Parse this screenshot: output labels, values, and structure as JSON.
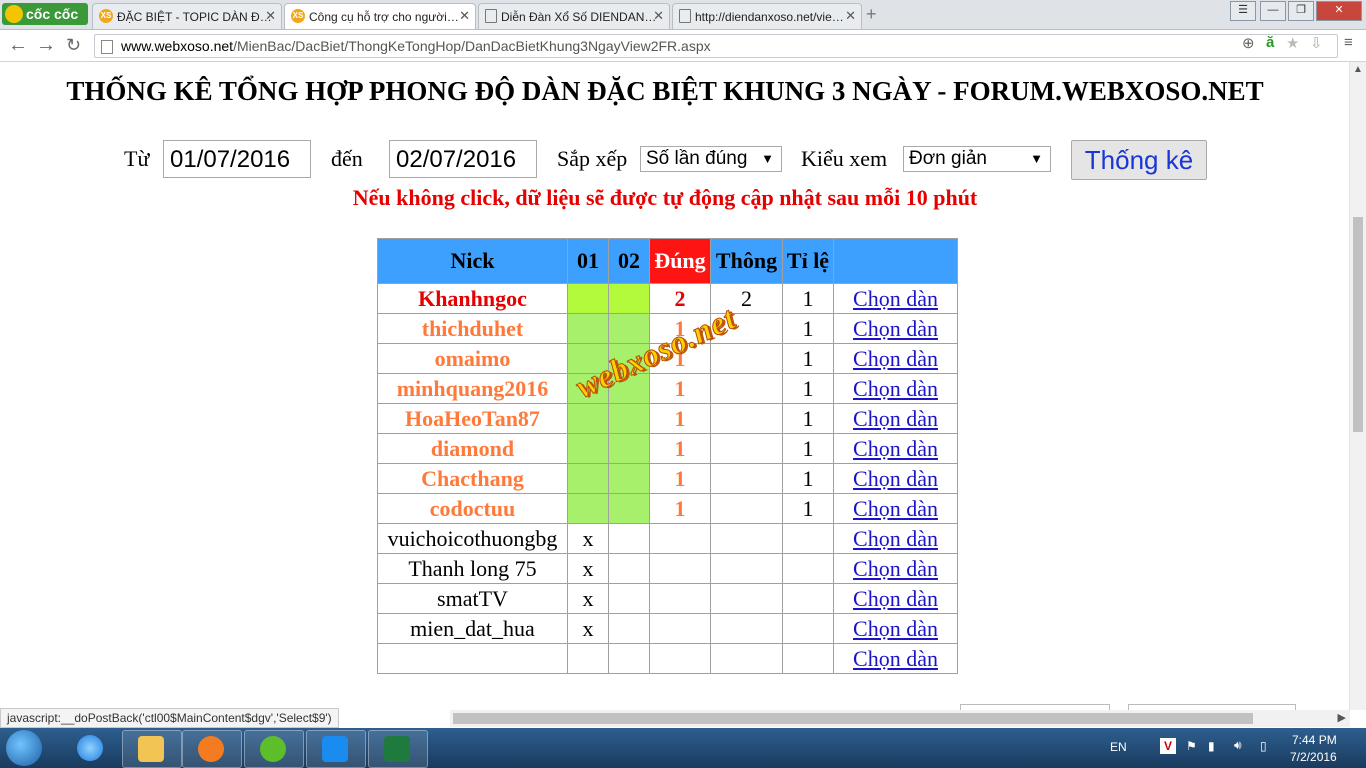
{
  "browser": {
    "logo_text": "cốc cốc",
    "tabs": [
      {
        "favicon": "XS",
        "label": "ĐẶC BIỆT - TOPIC DÀN Đ…"
      },
      {
        "favicon": "XS",
        "label": "Công cụ hỗ trợ cho người…"
      },
      {
        "favicon": "",
        "label": "Diễn Đàn Xổ Số DIENDAN…"
      },
      {
        "favicon": "",
        "label": "http://diendanxoso.net/vie…"
      }
    ],
    "url_host": "www.webxoso.net",
    "url_path": "/MienBac/DacBiet/ThongKeTongHop/DanDacBietKhung3NgayView2FR.aspx"
  },
  "page": {
    "title": "THỐNG KÊ TỔNG HỢP PHONG ĐỘ DÀN ĐẶC BIỆT KHUNG 3 NGÀY - FORUM.WEBXOSO.NET",
    "filters": {
      "from_label": "Từ",
      "from_value": "01/07/2016",
      "to_label": "đến",
      "to_value": "02/07/2016",
      "sort_label": "Sắp xếp",
      "sort_value": "Số lần đúng",
      "view_label": "Kiểu xem",
      "view_value": "Đơn giản",
      "submit_label": "Thống kê"
    },
    "notice": "Nếu không click, dữ liệu sẽ được tự động cập nhật sau mỗi 10 phút",
    "table": {
      "headers": {
        "nick": "Nick",
        "d1": "01",
        "d2": "02",
        "dung": "Đúng",
        "thong": "Thông",
        "tile": "Tỉ lệ"
      },
      "link_label": "Chọn dàn",
      "rows": [
        {
          "nick": "Khanhngoc",
          "d1": "",
          "d2": "",
          "dung": "2",
          "thong": "2",
          "tile": "1"
        },
        {
          "nick": "thichduhet",
          "d1": "",
          "d2": "",
          "dung": "1",
          "thong": "",
          "tile": "1"
        },
        {
          "nick": "omaimo",
          "d1": "",
          "d2": "",
          "dung": "1",
          "thong": "",
          "tile": "1"
        },
        {
          "nick": "minhquang2016",
          "d1": "",
          "d2": "",
          "dung": "1",
          "thong": "",
          "tile": "1"
        },
        {
          "nick": "HoaHeoTan87",
          "d1": "",
          "d2": "",
          "dung": "1",
          "thong": "",
          "tile": "1"
        },
        {
          "nick": "diamond",
          "d1": "",
          "d2": "",
          "dung": "1",
          "thong": "",
          "tile": "1"
        },
        {
          "nick": "Chacthang",
          "d1": "",
          "d2": "",
          "dung": "1",
          "thong": "",
          "tile": "1"
        },
        {
          "nick": "codoctuu",
          "d1": "",
          "d2": "",
          "dung": "1",
          "thong": "",
          "tile": "1"
        },
        {
          "nick": "vuichoicothuongbg",
          "d1": "x",
          "d2": "",
          "dung": "",
          "thong": "",
          "tile": ""
        },
        {
          "nick": "Thanh long 75",
          "d1": "x",
          "d2": "",
          "dung": "",
          "thong": "",
          "tile": ""
        },
        {
          "nick": "smatTV",
          "d1": "x",
          "d2": "",
          "dung": "",
          "thong": "",
          "tile": ""
        },
        {
          "nick": "mien_dat_hua",
          "d1": "x",
          "d2": "",
          "dung": "",
          "thong": "",
          "tile": ""
        },
        {
          "nick": "",
          "d1": "",
          "d2": "",
          "dung": "",
          "thong": "",
          "tile": ""
        }
      ]
    },
    "watermark": "webxoso.net",
    "status_text": "javascript:__doPostBack('ctl00$MainContent$dgv','Select$9')"
  },
  "taskbar": {
    "lang": "EN",
    "time": "7:44 PM",
    "date": "7/2/2016",
    "apps": [
      "ie-icon",
      "explorer-icon",
      "media-player-icon",
      "coccoc-icon",
      "zalo-icon",
      "excel-icon"
    ]
  },
  "colors": {
    "header_blue": "#3da0ff",
    "header_red": "#ff1414",
    "hit_green": "#a6f06c",
    "nick_orange": "#ff7a3a",
    "nick_red": "#e60000",
    "notice_red": "#e60000"
  }
}
